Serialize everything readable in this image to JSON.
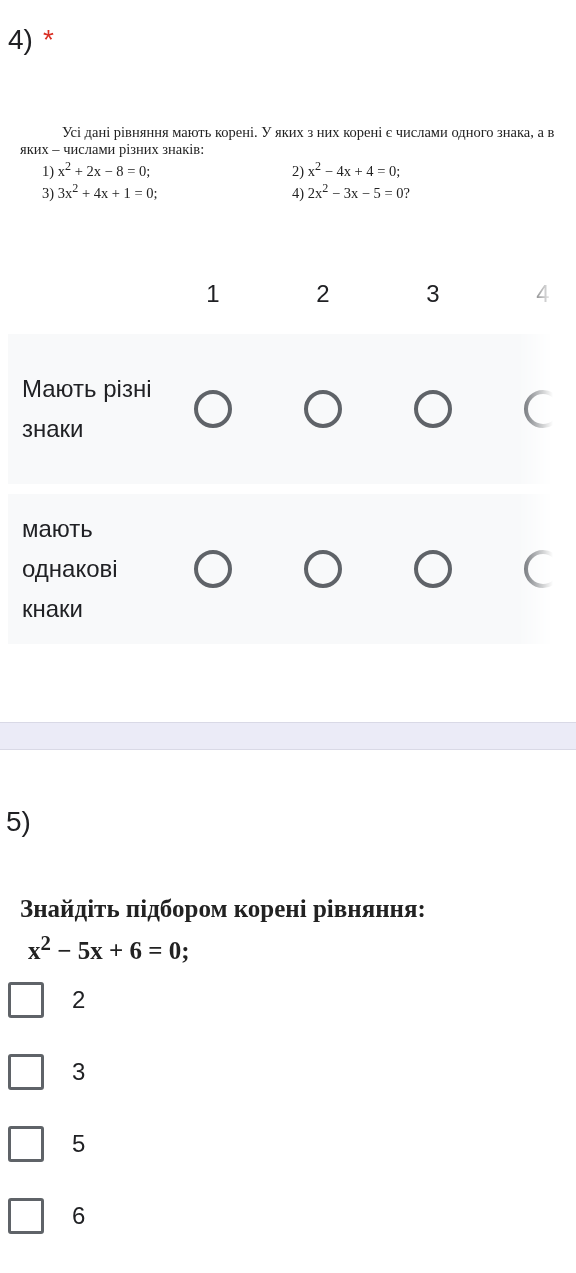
{
  "question_4": {
    "number": "4)",
    "required_mark": "*",
    "problem": {
      "intro": "Усі дані рівняння мають корені. У яких з них корені є числами одного знака, а в яких – числами різних знаків:",
      "equations": [
        "1) x$^{2}$ + 2x − 8 = 0;",
        "2) x$^{2}$ − 4x + 4 = 0;",
        "3) 3x$^{2}$ + 4x + 1 = 0;",
        "4) 2x$^{2}$ − 3x − 5 = 0?"
      ]
    },
    "grid": {
      "columns": [
        "1",
        "2",
        "3",
        "4"
      ],
      "rows": [
        {
          "label": "Мають різні знаки",
          "options": [
            {
              "selected": false
            },
            {
              "selected": false
            },
            {
              "selected": false
            },
            {
              "selected": false
            }
          ]
        },
        {
          "label": "мають однакові кнаки",
          "options": [
            {
              "selected": false
            },
            {
              "selected": false
            },
            {
              "selected": false
            },
            {
              "selected": false
            }
          ]
        }
      ]
    }
  },
  "question_5": {
    "number": "5)",
    "problem": {
      "intro": "Знайдіть підбором корені рівняння:",
      "equation": "x$^{2}$ − 5x + 6 = 0;"
    },
    "options": [
      {
        "label": "2",
        "checked": false
      },
      {
        "label": "3",
        "checked": false
      },
      {
        "label": "5",
        "checked": false
      },
      {
        "label": "6",
        "checked": false
      }
    ]
  }
}
